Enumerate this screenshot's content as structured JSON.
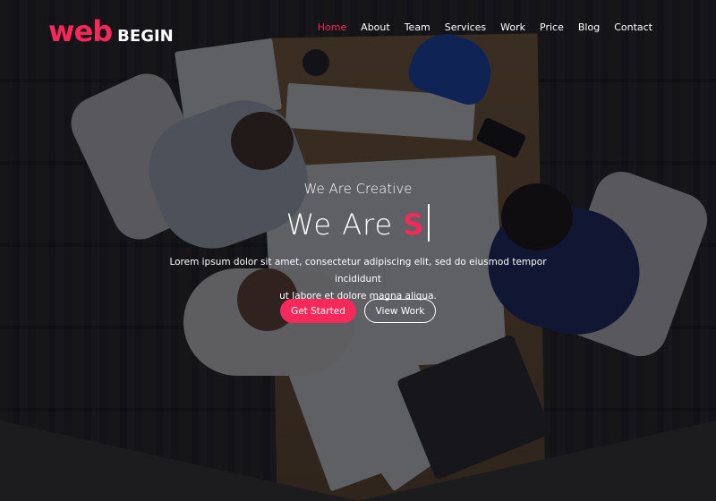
{
  "brand": {
    "logo_main": "web",
    "logo_secondary": "BEGIN"
  },
  "nav": {
    "items": [
      {
        "label": "Home",
        "active": true
      },
      {
        "label": "About"
      },
      {
        "label": "Team"
      },
      {
        "label": "Services"
      },
      {
        "label": "Work"
      },
      {
        "label": "Price"
      },
      {
        "label": "Blog"
      },
      {
        "label": "Contact"
      }
    ]
  },
  "hero": {
    "subtitle": "We Are Creative",
    "headline_prefix": "We Are",
    "headline_typed": "S",
    "description_line1": "Lorem ipsum dolor sit amet, consectetur adipiscing elit, sed do eiusmod tempor incididunt",
    "description_line2": "ut labore et dolore magna aliqua.",
    "primary_button": "Get Started",
    "secondary_button": "View Work"
  },
  "colors": {
    "accent": "#f7285a",
    "background": "#1c1c1f",
    "text": "#ffffff"
  }
}
